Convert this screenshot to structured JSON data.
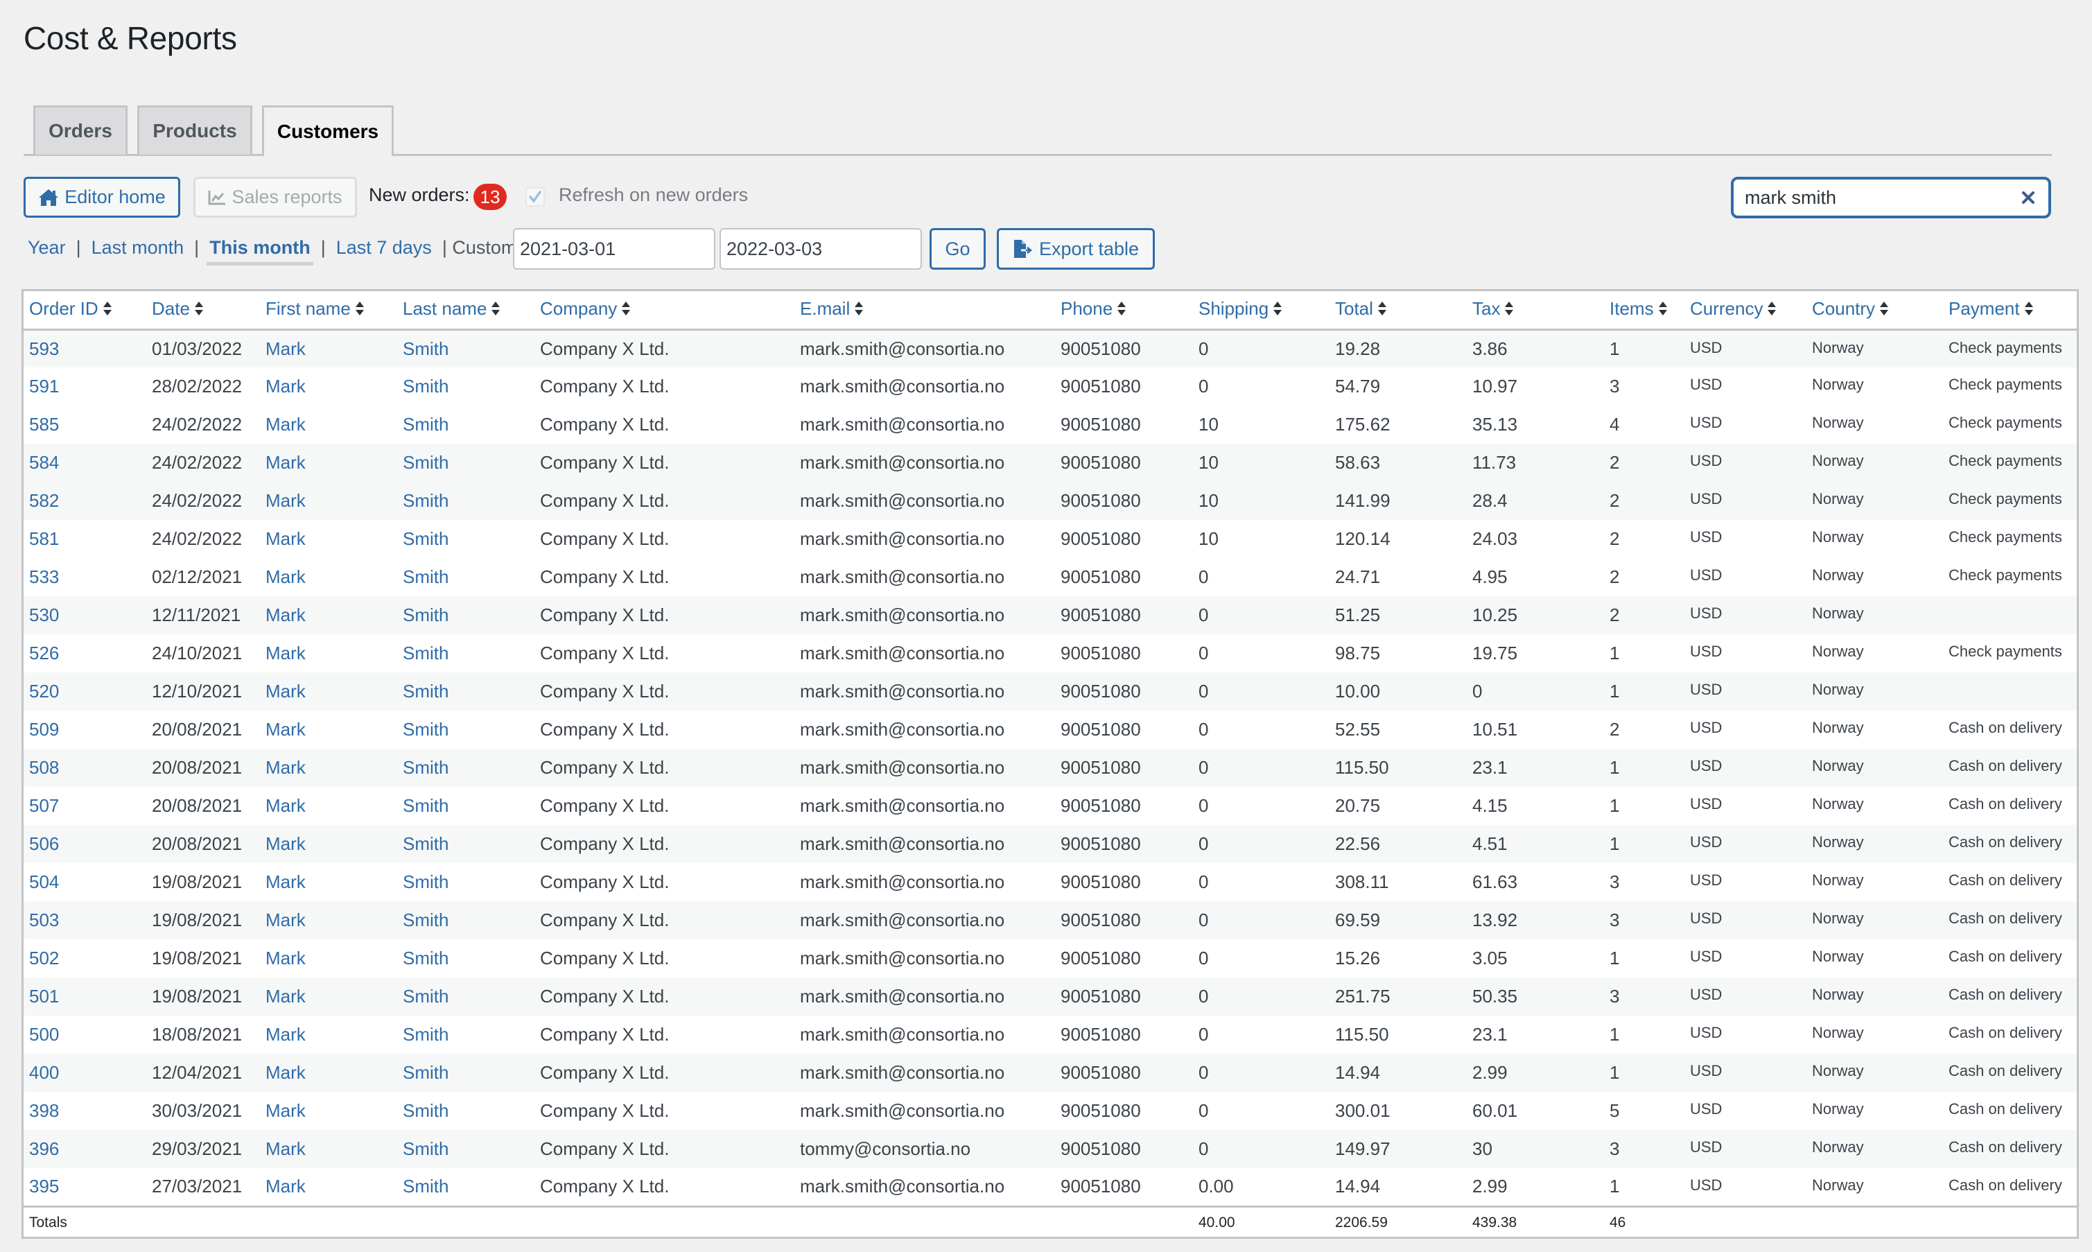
{
  "page": {
    "title": "Cost & Reports"
  },
  "tabs": [
    {
      "label": "Orders",
      "active": false
    },
    {
      "label": "Products",
      "active": false
    },
    {
      "label": "Customers",
      "active": true
    }
  ],
  "toolbar": {
    "editor_home_label": "Editor home",
    "editor_home_icon": "home-icon",
    "sales_reports_label": "Sales reports",
    "sales_reports_icon": "line-chart-icon",
    "new_orders_label": "New orders:",
    "new_orders_count": "13",
    "refresh_label": "Refresh on new orders",
    "refresh_checked": true
  },
  "search": {
    "value": "mark smith",
    "clear_icon": "close-icon"
  },
  "range": {
    "year": "Year",
    "last_month": "Last month",
    "this_month": "This month",
    "last_7_days": "Last 7 days",
    "custom_label": "Custom:",
    "separator": "|",
    "selected": "This month",
    "from": "2021-03-01",
    "to": "2022-03-03",
    "go_label": "Go",
    "export_label": "Export table",
    "export_icon": "file-export-icon"
  },
  "colors": {
    "accent": "#2f6ca8",
    "badge": "#e02a1f",
    "stripe": "#f6f7f7",
    "page_bg": "#f0f0f1"
  },
  "table": {
    "columns": [
      "Order ID",
      "Date",
      "First name",
      "Last name",
      "Company",
      "E.mail",
      "Phone",
      "Shipping",
      "Total",
      "Tax",
      "Items",
      "Currency",
      "Country",
      "Payment"
    ],
    "sort_icon": "sort-icon",
    "rows": [
      {
        "stripe": true,
        "cells": [
          "593",
          "01/03/2022",
          "Mark",
          "Smith",
          "Company X Ltd.",
          "mark.smith@consortia.no",
          "90051080",
          "0",
          "19.28",
          "3.86",
          "1",
          "USD",
          "Norway",
          "Check payments"
        ]
      },
      {
        "stripe": false,
        "cells": [
          "591",
          "28/02/2022",
          "Mark",
          "Smith",
          "Company X Ltd.",
          "mark.smith@consortia.no",
          "90051080",
          "0",
          "54.79",
          "10.97",
          "3",
          "USD",
          "Norway",
          "Check payments"
        ]
      },
      {
        "stripe": false,
        "cells": [
          "585",
          "24/02/2022",
          "Mark",
          "Smith",
          "Company X Ltd.",
          "mark.smith@consortia.no",
          "90051080",
          "10",
          "175.62",
          "35.13",
          "4",
          "USD",
          "Norway",
          "Check payments"
        ]
      },
      {
        "stripe": true,
        "cells": [
          "584",
          "24/02/2022",
          "Mark",
          "Smith",
          "Company X Ltd.",
          "mark.smith@consortia.no",
          "90051080",
          "10",
          "58.63",
          "11.73",
          "2",
          "USD",
          "Norway",
          "Check payments"
        ]
      },
      {
        "stripe": true,
        "cells": [
          "582",
          "24/02/2022",
          "Mark",
          "Smith",
          "Company X Ltd.",
          "mark.smith@consortia.no",
          "90051080",
          "10",
          "141.99",
          "28.4",
          "2",
          "USD",
          "Norway",
          "Check payments"
        ]
      },
      {
        "stripe": false,
        "cells": [
          "581",
          "24/02/2022",
          "Mark",
          "Smith",
          "Company X Ltd.",
          "mark.smith@consortia.no",
          "90051080",
          "10",
          "120.14",
          "24.03",
          "2",
          "USD",
          "Norway",
          "Check payments"
        ]
      },
      {
        "stripe": false,
        "cells": [
          "533",
          "02/12/2021",
          "Mark",
          "Smith",
          "Company X Ltd.",
          "mark.smith@consortia.no",
          "90051080",
          "0",
          "24.71",
          "4.95",
          "2",
          "USD",
          "Norway",
          "Check payments"
        ]
      },
      {
        "stripe": true,
        "cells": [
          "530",
          "12/11/2021",
          "Mark",
          "Smith",
          "Company X Ltd.",
          "mark.smith@consortia.no",
          "90051080",
          "0",
          "51.25",
          "10.25",
          "2",
          "USD",
          "Norway",
          ""
        ]
      },
      {
        "stripe": false,
        "cells": [
          "526",
          "24/10/2021",
          "Mark",
          "Smith",
          "Company X Ltd.",
          "mark.smith@consortia.no",
          "90051080",
          "0",
          "98.75",
          "19.75",
          "1",
          "USD",
          "Norway",
          "Check payments"
        ]
      },
      {
        "stripe": true,
        "cells": [
          "520",
          "12/10/2021",
          "Mark",
          "Smith",
          "Company X Ltd.",
          "mark.smith@consortia.no",
          "90051080",
          "0",
          "10.00",
          "0",
          "1",
          "USD",
          "Norway",
          ""
        ]
      },
      {
        "stripe": false,
        "cells": [
          "509",
          "20/08/2021",
          "Mark",
          "Smith",
          "Company X Ltd.",
          "mark.smith@consortia.no",
          "90051080",
          "0",
          "52.55",
          "10.51",
          "2",
          "USD",
          "Norway",
          "Cash on delivery"
        ]
      },
      {
        "stripe": true,
        "cells": [
          "508",
          "20/08/2021",
          "Mark",
          "Smith",
          "Company X Ltd.",
          "mark.smith@consortia.no",
          "90051080",
          "0",
          "115.50",
          "23.1",
          "1",
          "USD",
          "Norway",
          "Cash on delivery"
        ]
      },
      {
        "stripe": false,
        "cells": [
          "507",
          "20/08/2021",
          "Mark",
          "Smith",
          "Company X Ltd.",
          "mark.smith@consortia.no",
          "90051080",
          "0",
          "20.75",
          "4.15",
          "1",
          "USD",
          "Norway",
          "Cash on delivery"
        ]
      },
      {
        "stripe": true,
        "cells": [
          "506",
          "20/08/2021",
          "Mark",
          "Smith",
          "Company X Ltd.",
          "mark.smith@consortia.no",
          "90051080",
          "0",
          "22.56",
          "4.51",
          "1",
          "USD",
          "Norway",
          "Cash on delivery"
        ]
      },
      {
        "stripe": false,
        "cells": [
          "504",
          "19/08/2021",
          "Mark",
          "Smith",
          "Company X Ltd.",
          "mark.smith@consortia.no",
          "90051080",
          "0",
          "308.11",
          "61.63",
          "3",
          "USD",
          "Norway",
          "Cash on delivery"
        ]
      },
      {
        "stripe": true,
        "cells": [
          "503",
          "19/08/2021",
          "Mark",
          "Smith",
          "Company X Ltd.",
          "mark.smith@consortia.no",
          "90051080",
          "0",
          "69.59",
          "13.92",
          "3",
          "USD",
          "Norway",
          "Cash on delivery"
        ]
      },
      {
        "stripe": false,
        "cells": [
          "502",
          "19/08/2021",
          "Mark",
          "Smith",
          "Company X Ltd.",
          "mark.smith@consortia.no",
          "90051080",
          "0",
          "15.26",
          "3.05",
          "1",
          "USD",
          "Norway",
          "Cash on delivery"
        ]
      },
      {
        "stripe": true,
        "cells": [
          "501",
          "19/08/2021",
          "Mark",
          "Smith",
          "Company X Ltd.",
          "mark.smith@consortia.no",
          "90051080",
          "0",
          "251.75",
          "50.35",
          "3",
          "USD",
          "Norway",
          "Cash on delivery"
        ]
      },
      {
        "stripe": false,
        "cells": [
          "500",
          "18/08/2021",
          "Mark",
          "Smith",
          "Company X Ltd.",
          "mark.smith@consortia.no",
          "90051080",
          "0",
          "115.50",
          "23.1",
          "1",
          "USD",
          "Norway",
          "Cash on delivery"
        ]
      },
      {
        "stripe": true,
        "cells": [
          "400",
          "12/04/2021",
          "Mark",
          "Smith",
          "Company X Ltd.",
          "mark.smith@consortia.no",
          "90051080",
          "0",
          "14.94",
          "2.99",
          "1",
          "USD",
          "Norway",
          "Cash on delivery"
        ]
      },
      {
        "stripe": false,
        "cells": [
          "398",
          "30/03/2021",
          "Mark",
          "Smith",
          "Company X Ltd.",
          "mark.smith@consortia.no",
          "90051080",
          "0",
          "300.01",
          "60.01",
          "5",
          "USD",
          "Norway",
          "Cash on delivery"
        ]
      },
      {
        "stripe": true,
        "cells": [
          "396",
          "29/03/2021",
          "Mark",
          "Smith",
          "Company X Ltd.",
          "tommy@consortia.no",
          "90051080",
          "0",
          "149.97",
          "30",
          "3",
          "USD",
          "Norway",
          "Cash on delivery"
        ]
      },
      {
        "stripe": false,
        "cells": [
          "395",
          "27/03/2021",
          "Mark",
          "Smith",
          "Company X Ltd.",
          "mark.smith@consortia.no",
          "90051080",
          "0.00",
          "14.94",
          "2.99",
          "1",
          "USD",
          "Norway",
          "Cash on delivery"
        ]
      }
    ],
    "totals": {
      "label": "Totals",
      "shipping": "40.00",
      "total": "2206.59",
      "tax": "439.38",
      "items": "46"
    }
  }
}
